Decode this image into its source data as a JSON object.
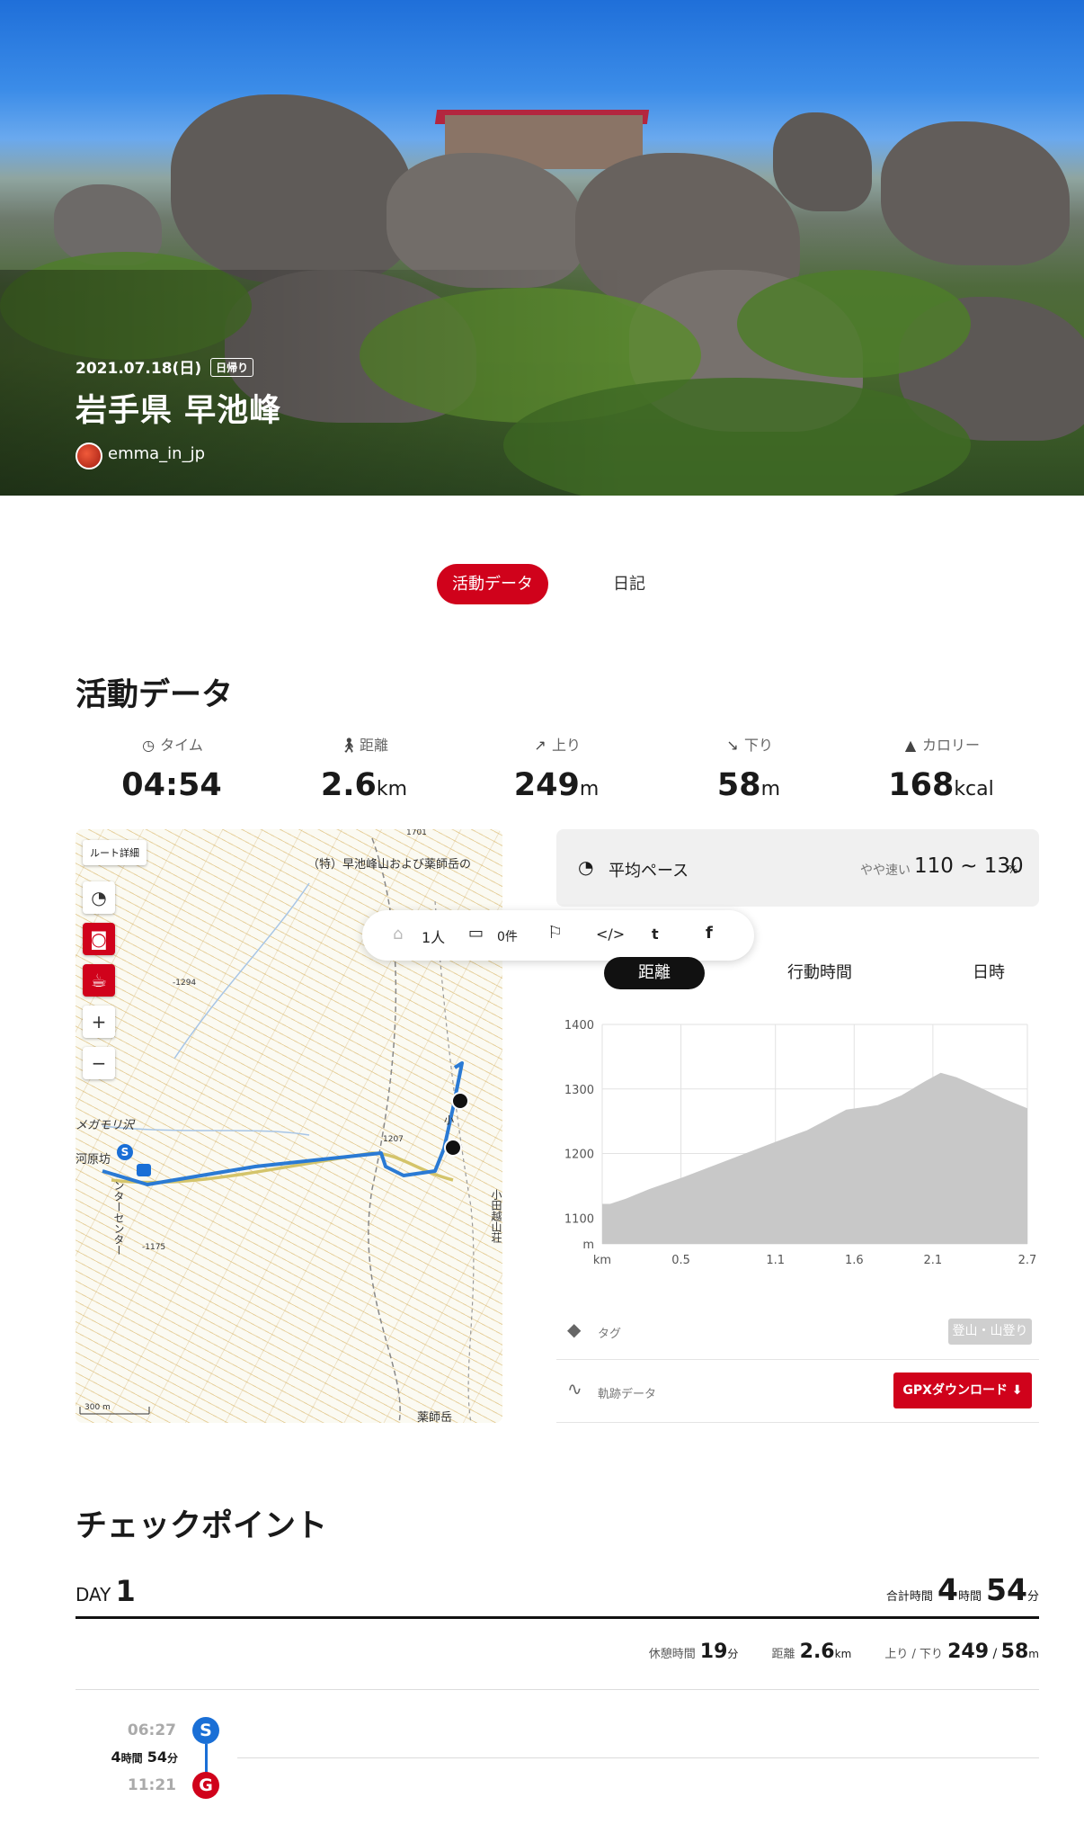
{
  "hero": {
    "date": "2021.07.18(日)",
    "trip_type": "日帰り",
    "title": "岩手県 早池峰",
    "username": "emma_in_jp"
  },
  "tabs": {
    "active": "活動データ",
    "other": "日記"
  },
  "activity": {
    "section_title": "活動データ",
    "stats": [
      {
        "label": "タイム",
        "icon": "stopwatch-icon",
        "value": "04:54",
        "unit": ""
      },
      {
        "label": "距離",
        "icon": "walker-icon",
        "value": "2.6",
        "unit": "km"
      },
      {
        "label": "上り",
        "icon": "arrow-up-right-icon",
        "value": "249",
        "unit": "m"
      },
      {
        "label": "下り",
        "icon": "arrow-down-right-icon",
        "value": "58",
        "unit": "m"
      },
      {
        "label": "カロリー",
        "icon": "flame-icon",
        "value": "168",
        "unit": "kcal"
      }
    ]
  },
  "map": {
    "route_detail": "ルート詳細",
    "label_top": "（特）早池峰山および薬師岳の",
    "label_marsh": "メガモリ沢",
    "label_kawara": "河原坊",
    "label_center": "ンターセンター",
    "label_odagoe": "小田越山荘",
    "label_yakushi": "薬師岳",
    "label_small": "小",
    "elev_1701": "1701",
    "elev_1294": "-1294",
    "elev_1207": "1207",
    "elev_1175": "-1175",
    "scale": "300 m"
  },
  "pace": {
    "label": "平均ペース",
    "qualifier": "やや速い",
    "range": "110 ~ 130",
    "unit": "%"
  },
  "share_bar": {
    "people": "1人",
    "comments": "0件"
  },
  "chart_tabs": [
    "距離",
    "行動時間",
    "日時"
  ],
  "chart_data": {
    "type": "area",
    "title": "",
    "xlabel": "km",
    "ylabel": "m",
    "x_ticks": [
      "km",
      "0.5",
      "1.1",
      "1.6",
      "2.1",
      "2.7"
    ],
    "y_ticks": [
      "m",
      "1100",
      "1200",
      "1300",
      "1400"
    ],
    "ylim": [
      1060,
      1400
    ],
    "xlim": [
      0,
      2.7
    ],
    "x": [
      0,
      0.05,
      0.15,
      0.3,
      0.5,
      0.8,
      1.1,
      1.3,
      1.55,
      1.75,
      1.9,
      2.05,
      2.15,
      2.25,
      2.4,
      2.55,
      2.7
    ],
    "y": [
      1122,
      1122,
      1130,
      1145,
      1162,
      1190,
      1218,
      1236,
      1268,
      1275,
      1290,
      1312,
      1325,
      1318,
      1302,
      1285,
      1270
    ],
    "grid": true,
    "color": "#c8c8c8"
  },
  "info": {
    "tag_label": "タグ",
    "tag_value": "登山・山登り",
    "track_label": "軌跡データ",
    "gpx_button": "GPXダウンロード"
  },
  "checkpoint": {
    "section_title": "チェックポイント",
    "day_label": "DAY",
    "day_number": "1",
    "total_label": "合計時間",
    "total_hours": "4",
    "hours_unit": "時間",
    "total_minutes": "54",
    "minutes_unit": "分",
    "rest_label": "休憩時間",
    "rest_value": "19",
    "rest_unit": "分",
    "distance_label": "距離",
    "distance_value": "2.6",
    "distance_unit": "km",
    "updown_label": "上り / 下り",
    "up_value": "249",
    "down_value": "58",
    "updown_unit": "m",
    "start_time": "06:27",
    "start_badge": "S",
    "duration_hours": "4",
    "duration_h_unit": "時間",
    "duration_minutes": "54",
    "duration_m_unit": "分",
    "end_time": "11:21",
    "end_badge": "G"
  },
  "colors": {
    "accent": "#d0021b",
    "route": "#2a7ad4",
    "start": "#1a6fd6",
    "goal": "#d0021b"
  }
}
